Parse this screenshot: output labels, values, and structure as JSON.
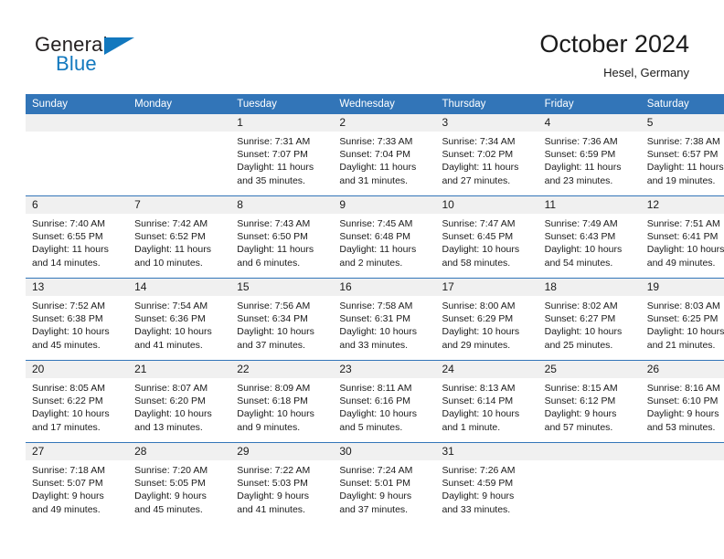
{
  "brand": {
    "name_part1": "General",
    "name_part2": "Blue",
    "icon": "triangle-logo-mark",
    "color_dark": "#231f20",
    "color_blue": "#1278be"
  },
  "header": {
    "title": "October 2024",
    "subtitle": "Hesel, Germany"
  },
  "theme": {
    "header_blue": "#3275b8",
    "band_gray": "#f0f0f0",
    "text": "#1a1a1a"
  },
  "weekday_headers": [
    "Sunday",
    "Monday",
    "Tuesday",
    "Wednesday",
    "Thursday",
    "Friday",
    "Saturday"
  ],
  "weeks": [
    [
      {
        "day": "",
        "sunrise": "",
        "sunset": "",
        "daylight_line1": "",
        "daylight_line2": "",
        "empty": true
      },
      {
        "day": "",
        "sunrise": "",
        "sunset": "",
        "daylight_line1": "",
        "daylight_line2": "",
        "empty": true
      },
      {
        "day": "1",
        "sunrise": "Sunrise: 7:31 AM",
        "sunset": "Sunset: 7:07 PM",
        "daylight_line1": "Daylight: 11 hours",
        "daylight_line2": "and 35 minutes."
      },
      {
        "day": "2",
        "sunrise": "Sunrise: 7:33 AM",
        "sunset": "Sunset: 7:04 PM",
        "daylight_line1": "Daylight: 11 hours",
        "daylight_line2": "and 31 minutes."
      },
      {
        "day": "3",
        "sunrise": "Sunrise: 7:34 AM",
        "sunset": "Sunset: 7:02 PM",
        "daylight_line1": "Daylight: 11 hours",
        "daylight_line2": "and 27 minutes."
      },
      {
        "day": "4",
        "sunrise": "Sunrise: 7:36 AM",
        "sunset": "Sunset: 6:59 PM",
        "daylight_line1": "Daylight: 11 hours",
        "daylight_line2": "and 23 minutes."
      },
      {
        "day": "5",
        "sunrise": "Sunrise: 7:38 AM",
        "sunset": "Sunset: 6:57 PM",
        "daylight_line1": "Daylight: 11 hours",
        "daylight_line2": "and 19 minutes."
      }
    ],
    [
      {
        "day": "6",
        "sunrise": "Sunrise: 7:40 AM",
        "sunset": "Sunset: 6:55 PM",
        "daylight_line1": "Daylight: 11 hours",
        "daylight_line2": "and 14 minutes."
      },
      {
        "day": "7",
        "sunrise": "Sunrise: 7:42 AM",
        "sunset": "Sunset: 6:52 PM",
        "daylight_line1": "Daylight: 11 hours",
        "daylight_line2": "and 10 minutes."
      },
      {
        "day": "8",
        "sunrise": "Sunrise: 7:43 AM",
        "sunset": "Sunset: 6:50 PM",
        "daylight_line1": "Daylight: 11 hours",
        "daylight_line2": "and 6 minutes."
      },
      {
        "day": "9",
        "sunrise": "Sunrise: 7:45 AM",
        "sunset": "Sunset: 6:48 PM",
        "daylight_line1": "Daylight: 11 hours",
        "daylight_line2": "and 2 minutes."
      },
      {
        "day": "10",
        "sunrise": "Sunrise: 7:47 AM",
        "sunset": "Sunset: 6:45 PM",
        "daylight_line1": "Daylight: 10 hours",
        "daylight_line2": "and 58 minutes."
      },
      {
        "day": "11",
        "sunrise": "Sunrise: 7:49 AM",
        "sunset": "Sunset: 6:43 PM",
        "daylight_line1": "Daylight: 10 hours",
        "daylight_line2": "and 54 minutes."
      },
      {
        "day": "12",
        "sunrise": "Sunrise: 7:51 AM",
        "sunset": "Sunset: 6:41 PM",
        "daylight_line1": "Daylight: 10 hours",
        "daylight_line2": "and 49 minutes."
      }
    ],
    [
      {
        "day": "13",
        "sunrise": "Sunrise: 7:52 AM",
        "sunset": "Sunset: 6:38 PM",
        "daylight_line1": "Daylight: 10 hours",
        "daylight_line2": "and 45 minutes."
      },
      {
        "day": "14",
        "sunrise": "Sunrise: 7:54 AM",
        "sunset": "Sunset: 6:36 PM",
        "daylight_line1": "Daylight: 10 hours",
        "daylight_line2": "and 41 minutes."
      },
      {
        "day": "15",
        "sunrise": "Sunrise: 7:56 AM",
        "sunset": "Sunset: 6:34 PM",
        "daylight_line1": "Daylight: 10 hours",
        "daylight_line2": "and 37 minutes."
      },
      {
        "day": "16",
        "sunrise": "Sunrise: 7:58 AM",
        "sunset": "Sunset: 6:31 PM",
        "daylight_line1": "Daylight: 10 hours",
        "daylight_line2": "and 33 minutes."
      },
      {
        "day": "17",
        "sunrise": "Sunrise: 8:00 AM",
        "sunset": "Sunset: 6:29 PM",
        "daylight_line1": "Daylight: 10 hours",
        "daylight_line2": "and 29 minutes."
      },
      {
        "day": "18",
        "sunrise": "Sunrise: 8:02 AM",
        "sunset": "Sunset: 6:27 PM",
        "daylight_line1": "Daylight: 10 hours",
        "daylight_line2": "and 25 minutes."
      },
      {
        "day": "19",
        "sunrise": "Sunrise: 8:03 AM",
        "sunset": "Sunset: 6:25 PM",
        "daylight_line1": "Daylight: 10 hours",
        "daylight_line2": "and 21 minutes."
      }
    ],
    [
      {
        "day": "20",
        "sunrise": "Sunrise: 8:05 AM",
        "sunset": "Sunset: 6:22 PM",
        "daylight_line1": "Daylight: 10 hours",
        "daylight_line2": "and 17 minutes."
      },
      {
        "day": "21",
        "sunrise": "Sunrise: 8:07 AM",
        "sunset": "Sunset: 6:20 PM",
        "daylight_line1": "Daylight: 10 hours",
        "daylight_line2": "and 13 minutes."
      },
      {
        "day": "22",
        "sunrise": "Sunrise: 8:09 AM",
        "sunset": "Sunset: 6:18 PM",
        "daylight_line1": "Daylight: 10 hours",
        "daylight_line2": "and 9 minutes."
      },
      {
        "day": "23",
        "sunrise": "Sunrise: 8:11 AM",
        "sunset": "Sunset: 6:16 PM",
        "daylight_line1": "Daylight: 10 hours",
        "daylight_line2": "and 5 minutes."
      },
      {
        "day": "24",
        "sunrise": "Sunrise: 8:13 AM",
        "sunset": "Sunset: 6:14 PM",
        "daylight_line1": "Daylight: 10 hours",
        "daylight_line2": "and 1 minute."
      },
      {
        "day": "25",
        "sunrise": "Sunrise: 8:15 AM",
        "sunset": "Sunset: 6:12 PM",
        "daylight_line1": "Daylight: 9 hours",
        "daylight_line2": "and 57 minutes."
      },
      {
        "day": "26",
        "sunrise": "Sunrise: 8:16 AM",
        "sunset": "Sunset: 6:10 PM",
        "daylight_line1": "Daylight: 9 hours",
        "daylight_line2": "and 53 minutes."
      }
    ],
    [
      {
        "day": "27",
        "sunrise": "Sunrise: 7:18 AM",
        "sunset": "Sunset: 5:07 PM",
        "daylight_line1": "Daylight: 9 hours",
        "daylight_line2": "and 49 minutes."
      },
      {
        "day": "28",
        "sunrise": "Sunrise: 7:20 AM",
        "sunset": "Sunset: 5:05 PM",
        "daylight_line1": "Daylight: 9 hours",
        "daylight_line2": "and 45 minutes."
      },
      {
        "day": "29",
        "sunrise": "Sunrise: 7:22 AM",
        "sunset": "Sunset: 5:03 PM",
        "daylight_line1": "Daylight: 9 hours",
        "daylight_line2": "and 41 minutes."
      },
      {
        "day": "30",
        "sunrise": "Sunrise: 7:24 AM",
        "sunset": "Sunset: 5:01 PM",
        "daylight_line1": "Daylight: 9 hours",
        "daylight_line2": "and 37 minutes."
      },
      {
        "day": "31",
        "sunrise": "Sunrise: 7:26 AM",
        "sunset": "Sunset: 4:59 PM",
        "daylight_line1": "Daylight: 9 hours",
        "daylight_line2": "and 33 minutes."
      },
      {
        "day": "",
        "sunrise": "",
        "sunset": "",
        "daylight_line1": "",
        "daylight_line2": "",
        "empty": true
      },
      {
        "day": "",
        "sunrise": "",
        "sunset": "",
        "daylight_line1": "",
        "daylight_line2": "",
        "empty": true
      }
    ]
  ]
}
